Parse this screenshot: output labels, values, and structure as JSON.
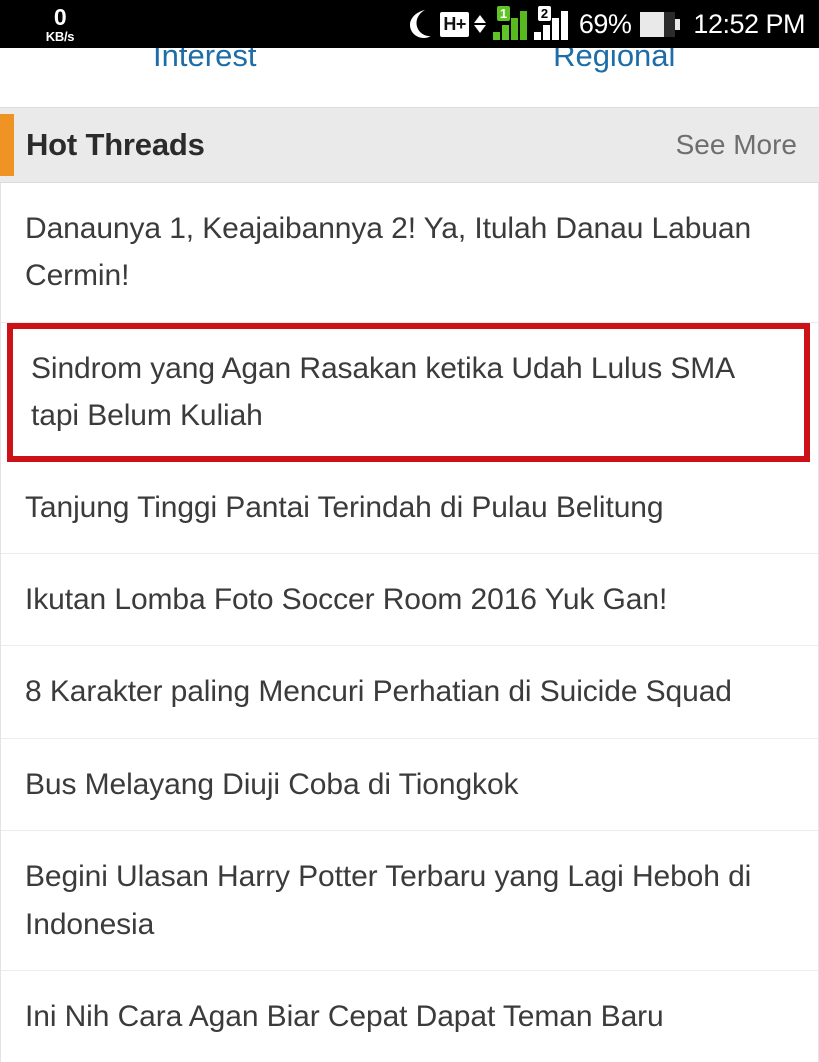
{
  "statusbar": {
    "network_speed_value": "0",
    "network_speed_unit": "KB/s",
    "dnd_icon": "crescent-moon-icon",
    "network_type": "H+",
    "data_arrows_icon": "data-up-down-arrows-icon",
    "sim1_label": "1",
    "sim2_label": "2",
    "battery_percent": "69%",
    "battery_icon": "battery-icon",
    "time": "12:52 PM"
  },
  "tabs": [
    {
      "label": "Interest"
    },
    {
      "label": "Regional"
    }
  ],
  "section": {
    "title": "Hot Threads",
    "see_more_label": "See More",
    "accent_color": "#ef9324",
    "background_color": "#eaeaea"
  },
  "highlight": {
    "color": "#cc1216",
    "target_index": 1
  },
  "threads": [
    {
      "title": "Danaunya 1, Keajaibannya 2! Ya, Itulah Danau Labuan Cermin!"
    },
    {
      "title": "Sindrom yang Agan Rasakan ketika Udah Lulus SMA tapi Belum Kuliah"
    },
    {
      "title": "Tanjung Tinggi Pantai Terindah di Pulau Belitung"
    },
    {
      "title": "Ikutan Lomba Foto Soccer Room 2016 Yuk Gan!"
    },
    {
      "title": "8 Karakter paling Mencuri Perhatian di Suicide Squad"
    },
    {
      "title": "Bus Melayang Diuji Coba di Tiongkok"
    },
    {
      "title": "Begini Ulasan Harry Potter Terbaru yang Lagi Heboh di Indonesia"
    },
    {
      "title": "Ini Nih Cara Agan Biar Cepat Dapat Teman Baru"
    }
  ]
}
